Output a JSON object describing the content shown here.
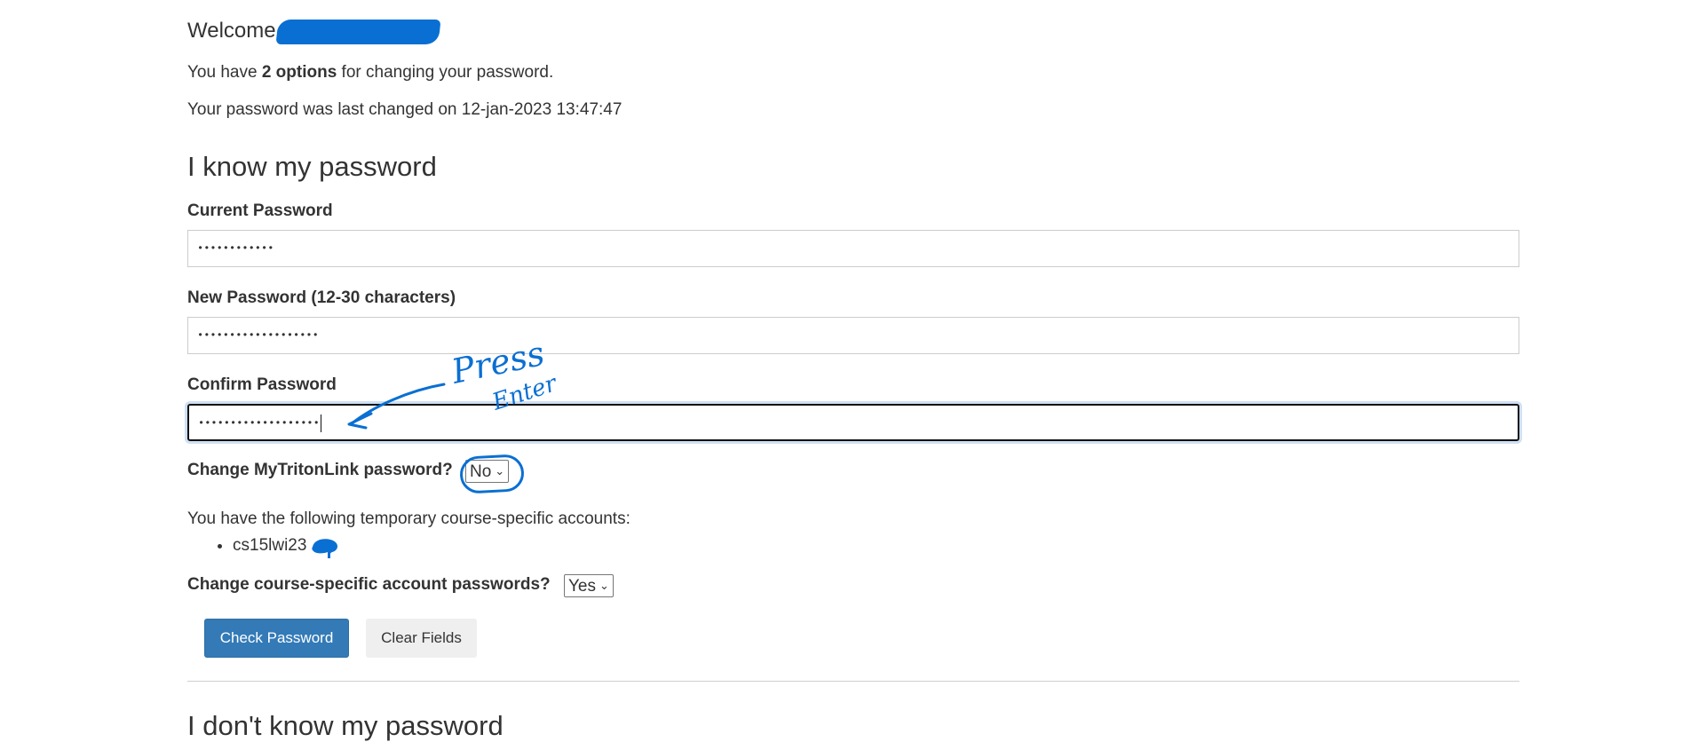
{
  "welcome": {
    "text": "Welcome,"
  },
  "intro": {
    "options_prefix": "You have ",
    "options_bold": "2 options",
    "options_suffix": " for changing your password.",
    "last_changed": "Your password was last changed on 12-jan-2023 13:47:47"
  },
  "section_known": {
    "title": "I know my password",
    "current_label": "Current Password",
    "current_value": "••••••••••••",
    "new_label": "New Password (12-30 characters)",
    "new_value": "•••••••••••••••••••",
    "confirm_label": "Confirm Password",
    "confirm_value": "•••••••••••••••••••"
  },
  "mytritonlink": {
    "label": "Change MyTritonLink password?",
    "selected": "No"
  },
  "course_accounts": {
    "intro": "You have the following temporary course-specific accounts:",
    "items": [
      "cs15lwi23"
    ],
    "change_label": "Change course-specific account passwords?",
    "selected": "Yes"
  },
  "buttons": {
    "check": "Check Password",
    "clear": "Clear Fields"
  },
  "section_unknown": {
    "title": "I don't know my password"
  },
  "annotation": {
    "line1": "Press",
    "line2": "Enter"
  },
  "colors": {
    "primary": "#337ab7",
    "annotation": "#0a6fd2"
  }
}
